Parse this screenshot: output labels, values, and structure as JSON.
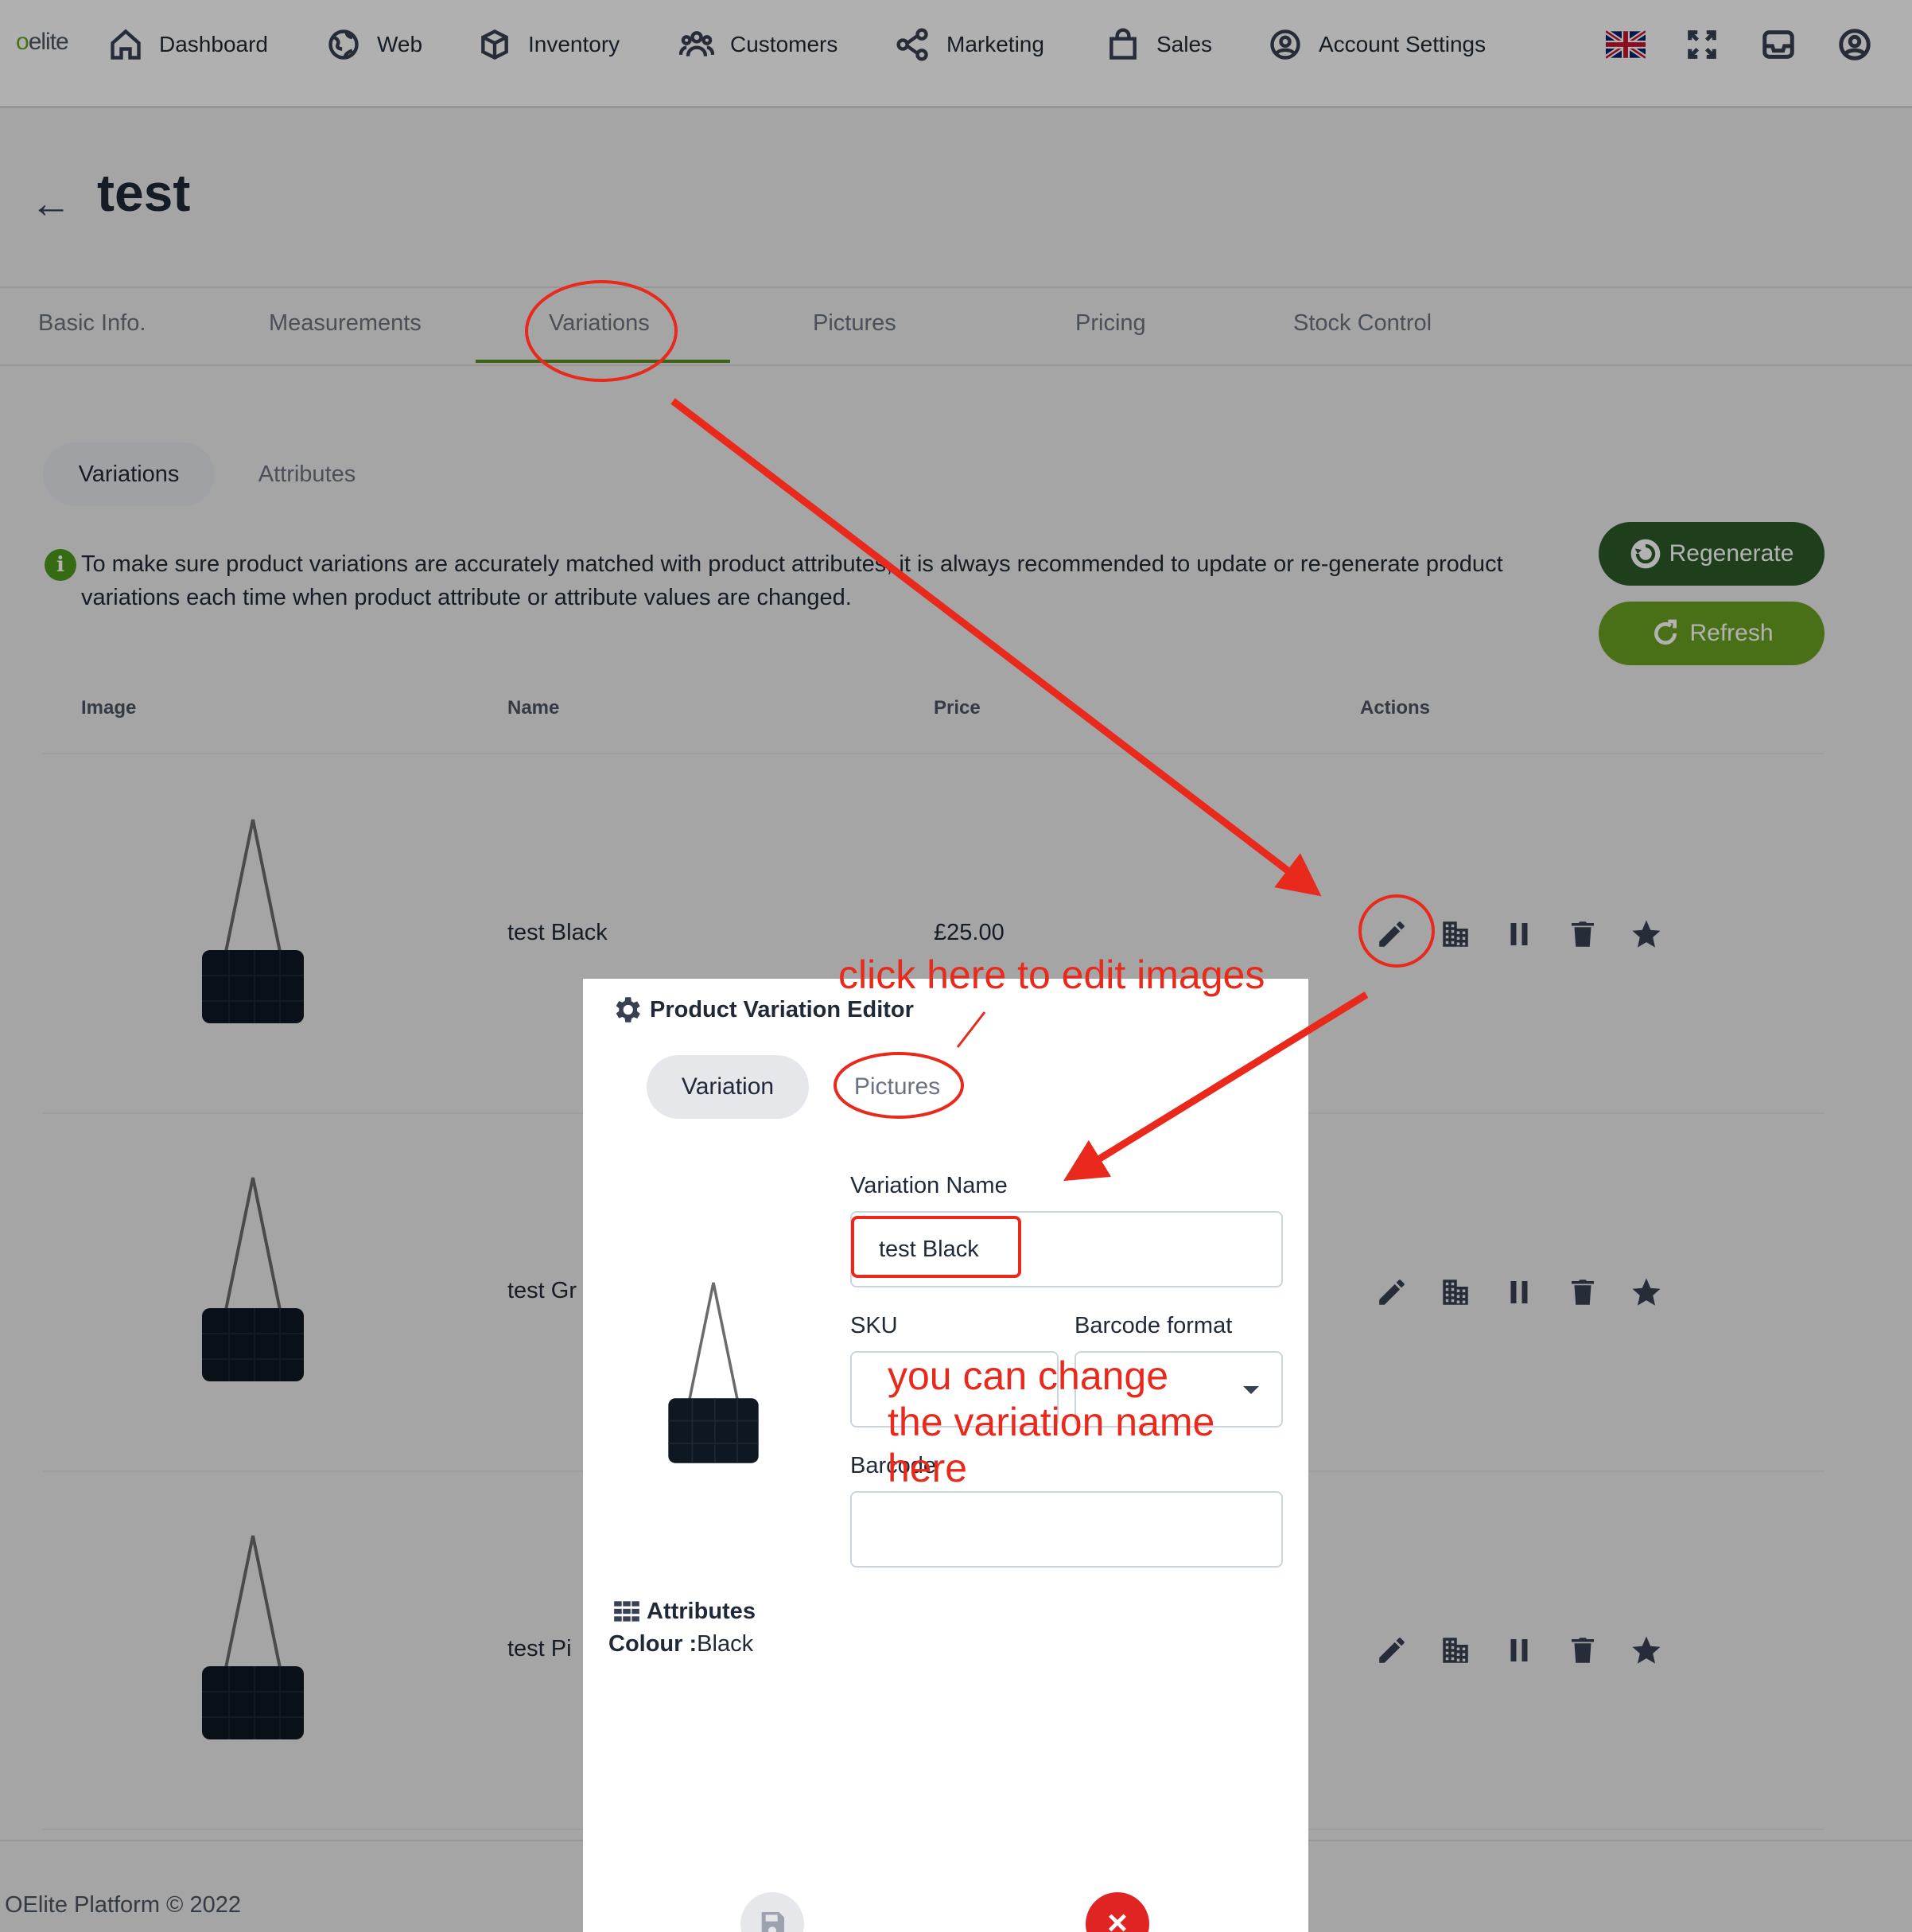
{
  "app": {
    "logo_prefix": "o",
    "logo_suffix": "elite"
  },
  "nav": {
    "items": [
      {
        "label": "Dashboard",
        "icon": "home-icon"
      },
      {
        "label": "Web",
        "icon": "globe-icon"
      },
      {
        "label": "Inventory",
        "icon": "box-icon"
      },
      {
        "label": "Customers",
        "icon": "users-icon"
      },
      {
        "label": "Marketing",
        "icon": "share-icon"
      },
      {
        "label": "Sales",
        "icon": "shopping-bag-icon"
      },
      {
        "label": "Account Settings",
        "icon": "user-circle-icon"
      }
    ],
    "right_icons": [
      "uk-flag-icon",
      "fullscreen-icon",
      "inbox-icon",
      "profile-icon"
    ]
  },
  "page": {
    "title": "test",
    "back_icon": "back-arrow-icon"
  },
  "tabs": [
    "Basic Info.",
    "Measurements",
    "Variations",
    "Pictures",
    "Pricing",
    "Stock Control"
  ],
  "active_tab": "Variations",
  "subtabs": [
    "Variations",
    "Attributes"
  ],
  "active_subtab": "Variations",
  "notice": {
    "icon": "i",
    "text": "To make sure product variations are accurately matched with product attributes, it is always recommended to update or re-generate product variations each time when product attribute or attribute values are changed."
  },
  "buttons": {
    "regenerate": "Regenerate",
    "refresh": "Refresh"
  },
  "table": {
    "headers": [
      "Image",
      "Name",
      "Price",
      "Actions"
    ],
    "rows": [
      {
        "name": "test Black",
        "price": "£25.00"
      },
      {
        "name": "test Gr",
        "price": ""
      },
      {
        "name": "test Pi",
        "price": ""
      }
    ],
    "action_icons": [
      "edit-icon",
      "warehouse-icon",
      "pause-icon",
      "trash-icon",
      "star-icon"
    ]
  },
  "footer": {
    "text": "OElite Platform © 2022"
  },
  "modal": {
    "title": "Product Variation Editor",
    "tabs": [
      "Variation",
      "Pictures"
    ],
    "active_tab": "Variation",
    "variation_name_label": "Variation Name",
    "variation_name_value": "test Black",
    "sku_label": "SKU",
    "sku_value": "",
    "barcode_format_label": "Barcode format",
    "barcode_format_value": "",
    "barcode_label": "Barcode",
    "barcode_value": "",
    "attributes_title": "Attributes",
    "attribute_name": "Colour :",
    "attribute_value": "Black"
  },
  "annotations": {
    "edit_images": "click here to edit images",
    "change_name": "you can change the variation name here",
    "color": "#e8291c"
  },
  "colors": {
    "accent_green": "#6aa121",
    "dark_green": "#2d5a27",
    "danger": "#e02424"
  }
}
